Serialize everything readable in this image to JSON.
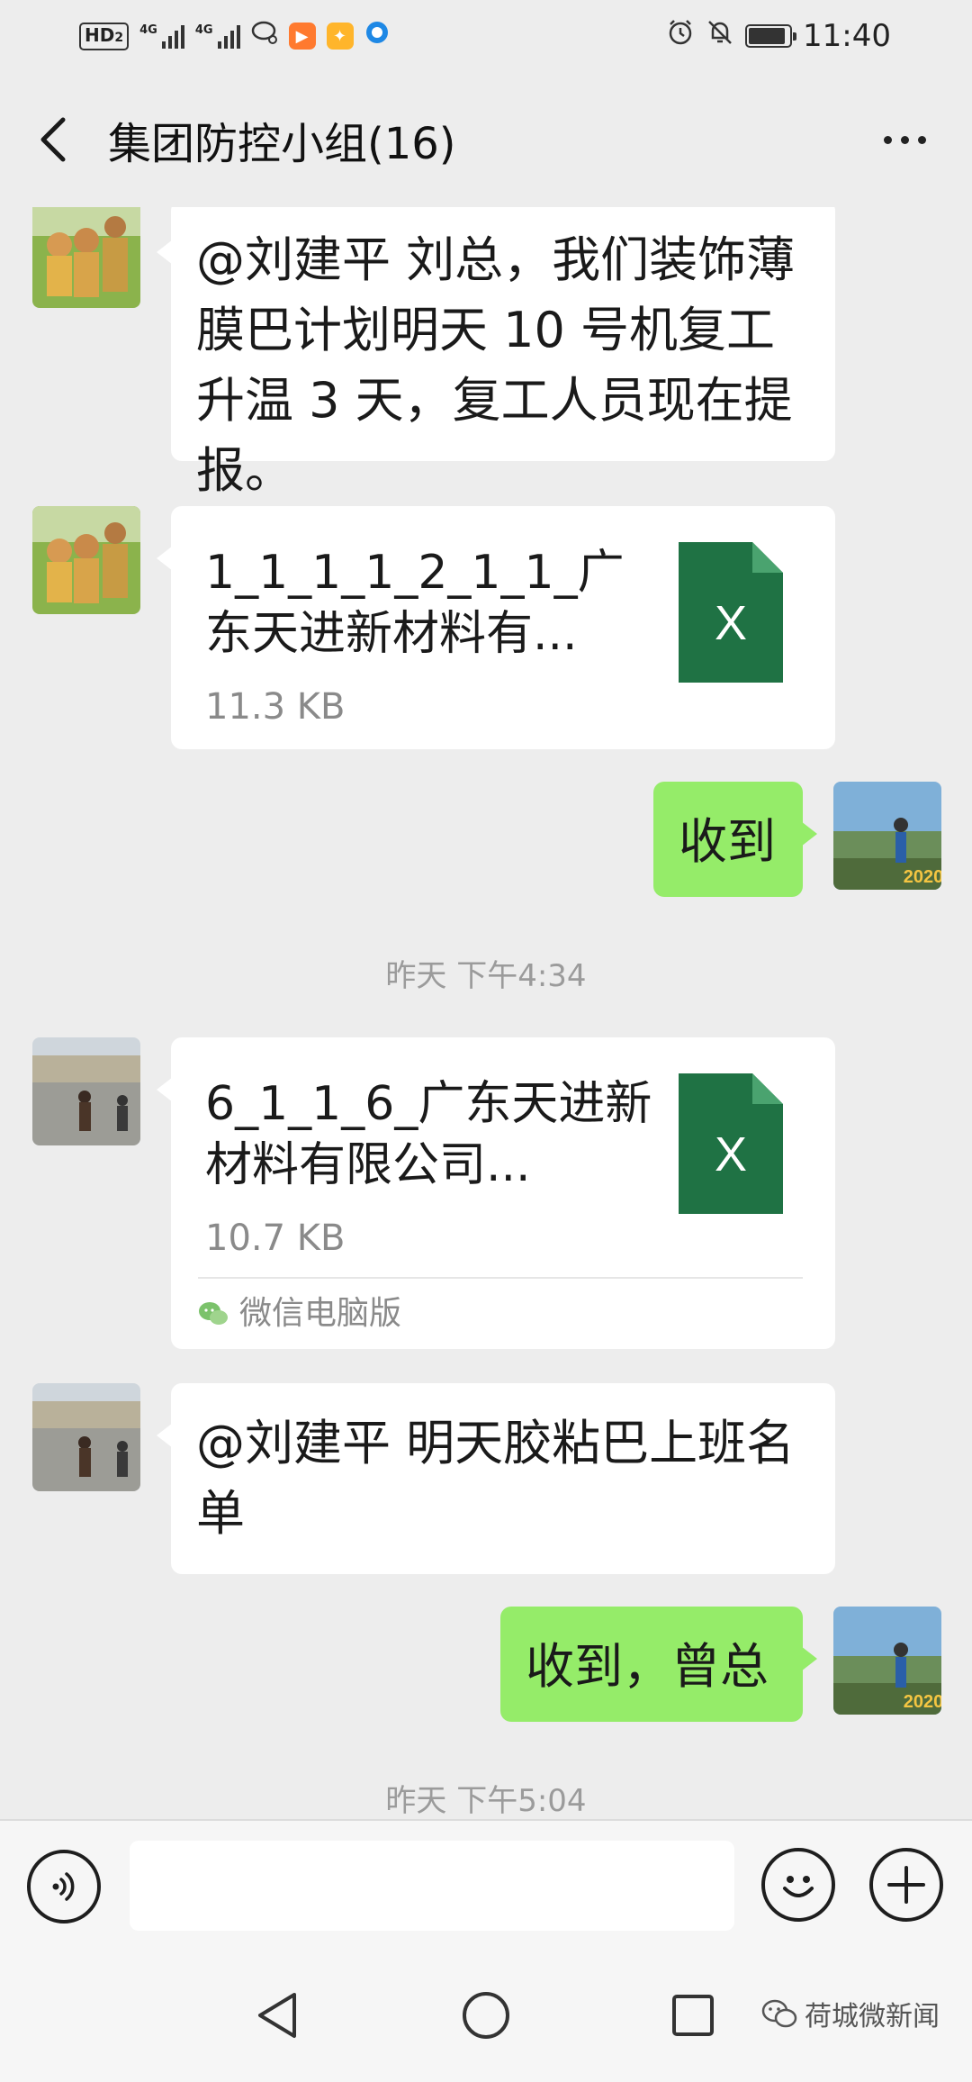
{
  "status_bar": {
    "network_tag": "HD",
    "network_sub": "2",
    "signal1_label": "4G",
    "signal2_label": "4G",
    "time": "11:40",
    "battery_level": 0.9
  },
  "header": {
    "title": "集团防控小组(16)"
  },
  "messages": [
    {
      "type": "text",
      "side": "left",
      "text": "@刘建平  刘总，我们装饰薄膜巴计划明天 10 号机复工升温 3 天，复工人员现在提报。"
    },
    {
      "type": "file",
      "side": "left",
      "file_name": "1_1_1_1_2_1_1_广东天进新材料有...",
      "file_size": "11.3 KB",
      "file_icon_letter": "X"
    },
    {
      "type": "text",
      "side": "right",
      "text": "收到"
    },
    {
      "type": "time",
      "text": "昨天 下午4:34"
    },
    {
      "type": "file",
      "side": "left",
      "file_name": "6_1_1_6_广东天进新材料有限公司...",
      "file_size": "10.7 KB",
      "file_icon_letter": "X",
      "source": "微信电脑版"
    },
    {
      "type": "text",
      "side": "left",
      "text": "@刘建平  明天胶粘巴上班名单"
    },
    {
      "type": "text",
      "side": "right",
      "text": "收到，曾总"
    },
    {
      "type": "time",
      "text": "昨天 下午5:04"
    }
  ],
  "avatar_badge": "2020",
  "input_bar": {
    "voice_icon": "voice-icon",
    "emoji_icon": "emoji-icon",
    "plus_icon": "plus-icon",
    "input_value": ""
  },
  "watermark": "荷城微新闻",
  "colors": {
    "background": "#ededed",
    "bubble_green": "#95ec69",
    "excel_green": "#1f7244"
  }
}
